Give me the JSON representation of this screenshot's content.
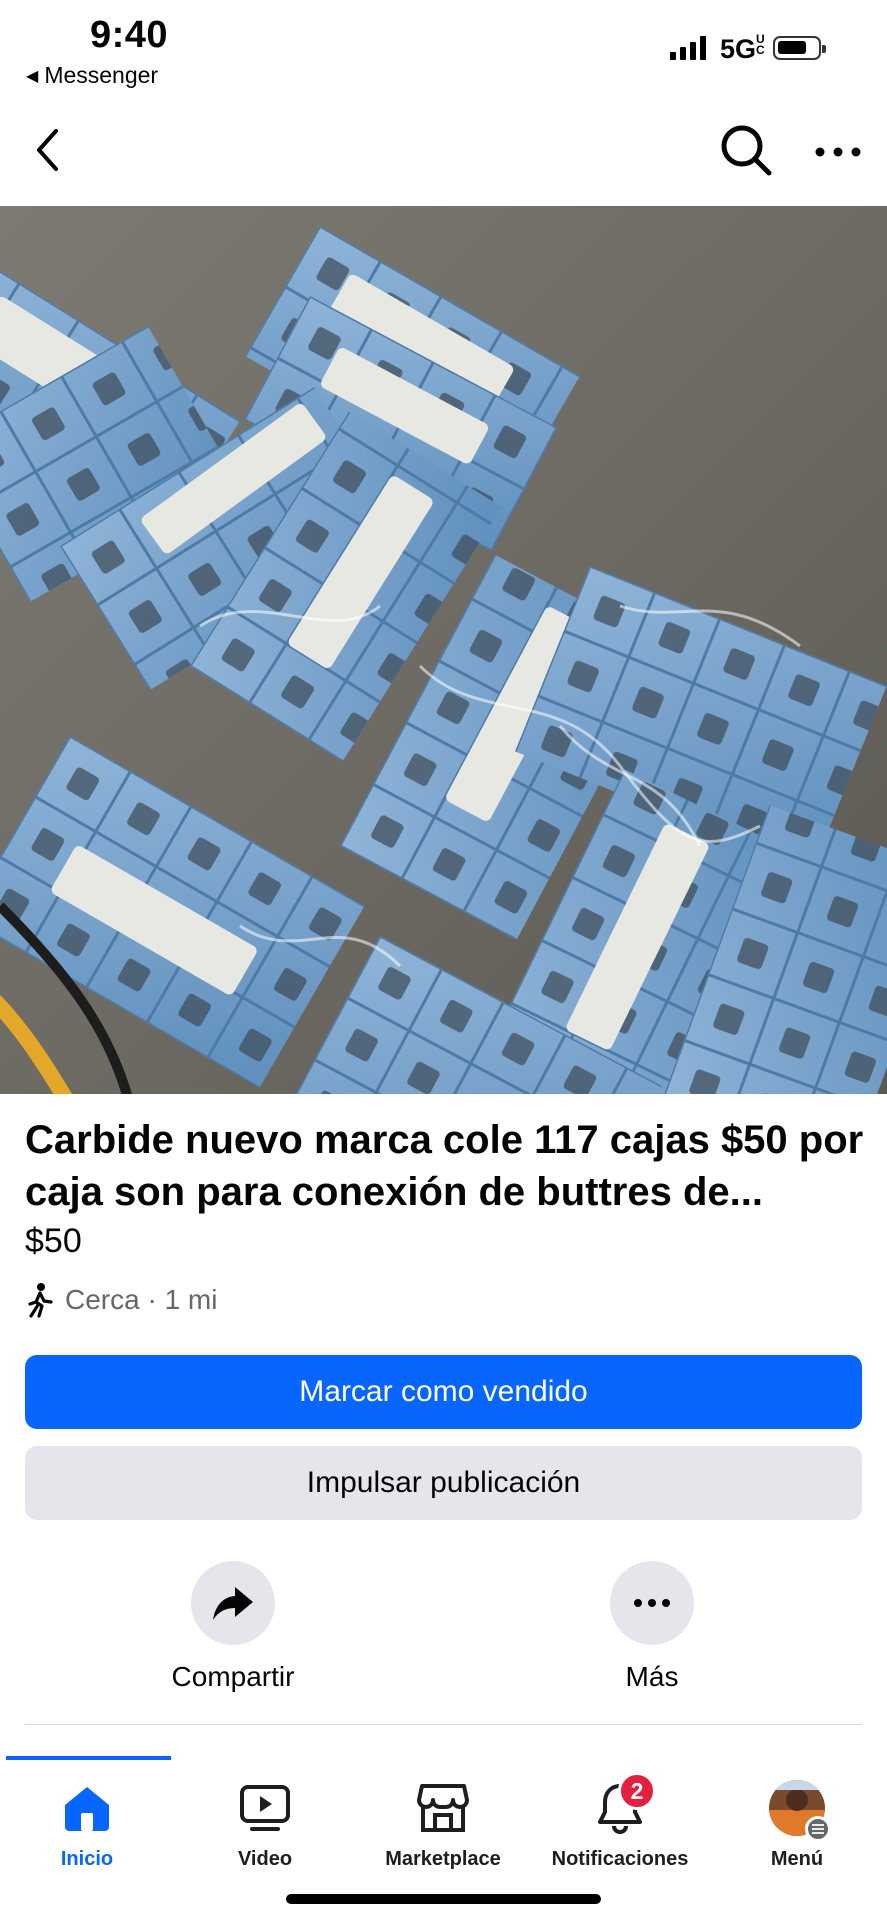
{
  "status_bar": {
    "time": "9:40",
    "back_app": "Messenger",
    "network": "5G",
    "network_suffix": "UC",
    "back_arrow_icon": "back-triangle-icon"
  },
  "header": {
    "back_icon": "chevron-left-icon",
    "search_icon": "search-icon",
    "more_icon": "more-dots-icon"
  },
  "listing": {
    "photo_description_icon": "product-photo",
    "title": "Carbide nuevo marca cole 117 cajas $50 por caja son para conexión de buttres de...",
    "price": "$50",
    "location": "Cerca · 1 mi",
    "location_icon": "walking-person-icon"
  },
  "buttons": {
    "mark_sold": "Marcar como vendido",
    "boost": "Impulsar publicación"
  },
  "actions": [
    {
      "label": "Compartir",
      "icon": "share-arrow-icon"
    },
    {
      "label": "Más",
      "icon": "more-dots-icon"
    }
  ],
  "tabbar": {
    "tabs": [
      {
        "label": "Inicio",
        "icon": "home-icon",
        "active": true
      },
      {
        "label": "Video",
        "icon": "video-icon"
      },
      {
        "label": "Marketplace",
        "icon": "marketplace-icon"
      },
      {
        "label": "Notificaciones",
        "icon": "bell-icon",
        "badge": "2"
      },
      {
        "label": "Menú",
        "icon": "avatar-icon"
      }
    ]
  },
  "colors": {
    "accent": "#0866ff",
    "secondary_button": "#e4e6eb",
    "badge": "#e41e3f",
    "muted_text": "#65676b"
  }
}
